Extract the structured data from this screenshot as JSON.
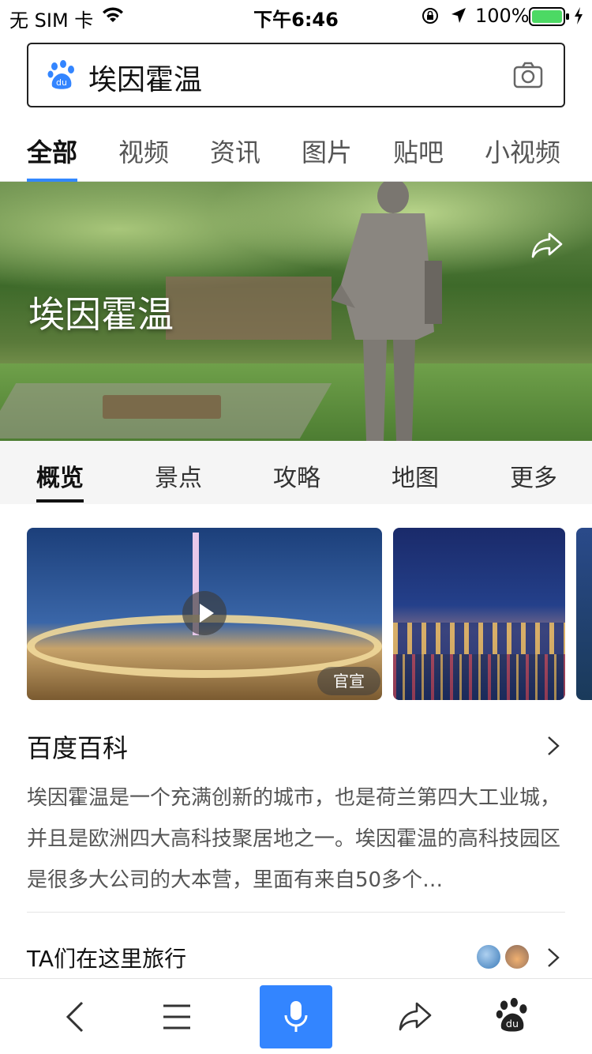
{
  "status_bar": {
    "carrier": "无 SIM 卡",
    "time": "下午6:46",
    "battery": "100%",
    "battery_color": "#4cd964"
  },
  "search": {
    "query": "埃因霍温",
    "logo_icon": "baidu-paw-icon",
    "camera_icon": "camera-icon"
  },
  "tabs": [
    {
      "label": "全部",
      "active": true
    },
    {
      "label": "视频"
    },
    {
      "label": "资讯"
    },
    {
      "label": "图片"
    },
    {
      "label": "贴吧"
    },
    {
      "label": "小视频"
    }
  ],
  "accent_color": "#3385ff",
  "hero": {
    "title": "埃因霍温",
    "share_icon": "share-icon"
  },
  "subtabs": [
    {
      "label": "概览",
      "active": true
    },
    {
      "label": "景点"
    },
    {
      "label": "攻略"
    },
    {
      "label": "地图"
    },
    {
      "label": "更多"
    }
  ],
  "media": {
    "badge": "官宣",
    "play_icon": "play-icon"
  },
  "baike": {
    "title": "百度百科",
    "text": "埃因霍温是一个充满创新的城市，也是荷兰第四大工业城，并且是欧洲四大高科技聚居地之一。埃因霍温的高科技园区是很多大公司的大本营，里面有来自50多个…"
  },
  "travel": {
    "title": "TA们在这里旅行"
  },
  "bottom_bar": {
    "icons": [
      "back-icon",
      "menu-icon",
      "microphone-icon",
      "share-icon",
      "baidu-paw-icon"
    ]
  }
}
